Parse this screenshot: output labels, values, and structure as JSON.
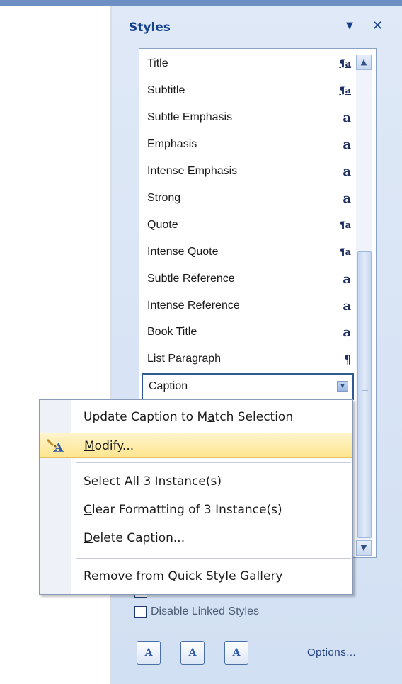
{
  "panel": {
    "title": "Styles",
    "dropdown_glyph": "▼",
    "close_glyph": "✕"
  },
  "styles": [
    {
      "name": "Title",
      "type": "linked",
      "glyph": "¶a"
    },
    {
      "name": "Subtitle",
      "type": "linked",
      "glyph": "¶a"
    },
    {
      "name": "Subtle Emphasis",
      "type": "character",
      "glyph": "a"
    },
    {
      "name": "Emphasis",
      "type": "character",
      "glyph": "a"
    },
    {
      "name": "Intense Emphasis",
      "type": "character",
      "glyph": "a"
    },
    {
      "name": "Strong",
      "type": "character",
      "glyph": "a"
    },
    {
      "name": "Quote",
      "type": "linked",
      "glyph": "¶a"
    },
    {
      "name": "Intense Quote",
      "type": "linked",
      "glyph": "¶a"
    },
    {
      "name": "Subtle Reference",
      "type": "character",
      "glyph": "a"
    },
    {
      "name": "Intense Reference",
      "type": "character",
      "glyph": "a"
    },
    {
      "name": "Book Title",
      "type": "character",
      "glyph": "a"
    },
    {
      "name": "List Paragraph",
      "type": "paragraph",
      "glyph": "¶"
    }
  ],
  "selected_style": {
    "name": "Caption",
    "dropdown_glyph": "▼"
  },
  "scroll": {
    "up_glyph": "▲",
    "down_glyph": "▼"
  },
  "context_menu": {
    "items": [
      {
        "pre": "Update Caption to M",
        "accel": "a",
        "post": "tch Selection"
      },
      {
        "pre": "",
        "accel": "M",
        "post": "odify...",
        "highlighted": true
      },
      {
        "pre": "",
        "accel": "S",
        "post": "elect All 3 Instance(s)"
      },
      {
        "pre": "",
        "accel": "C",
        "post": "lear Formatting of 3 Instance(s)"
      },
      {
        "pre": "",
        "accel": "D",
        "post": "elete Caption..."
      },
      {
        "pre": "Remove from ",
        "accel": "Q",
        "post": "uick Style Gallery"
      }
    ]
  },
  "checkbox": {
    "label": "Disable Linked Styles",
    "checked": false
  },
  "buttons": {
    "new_style_glyph": "A",
    "inspector_glyph": "A",
    "manage_styles_glyph": "A",
    "options_label": "Options..."
  },
  "colors": {
    "title": "#15428b",
    "highlight": "#fde58e",
    "panel_bg": "#dfe9f7"
  }
}
